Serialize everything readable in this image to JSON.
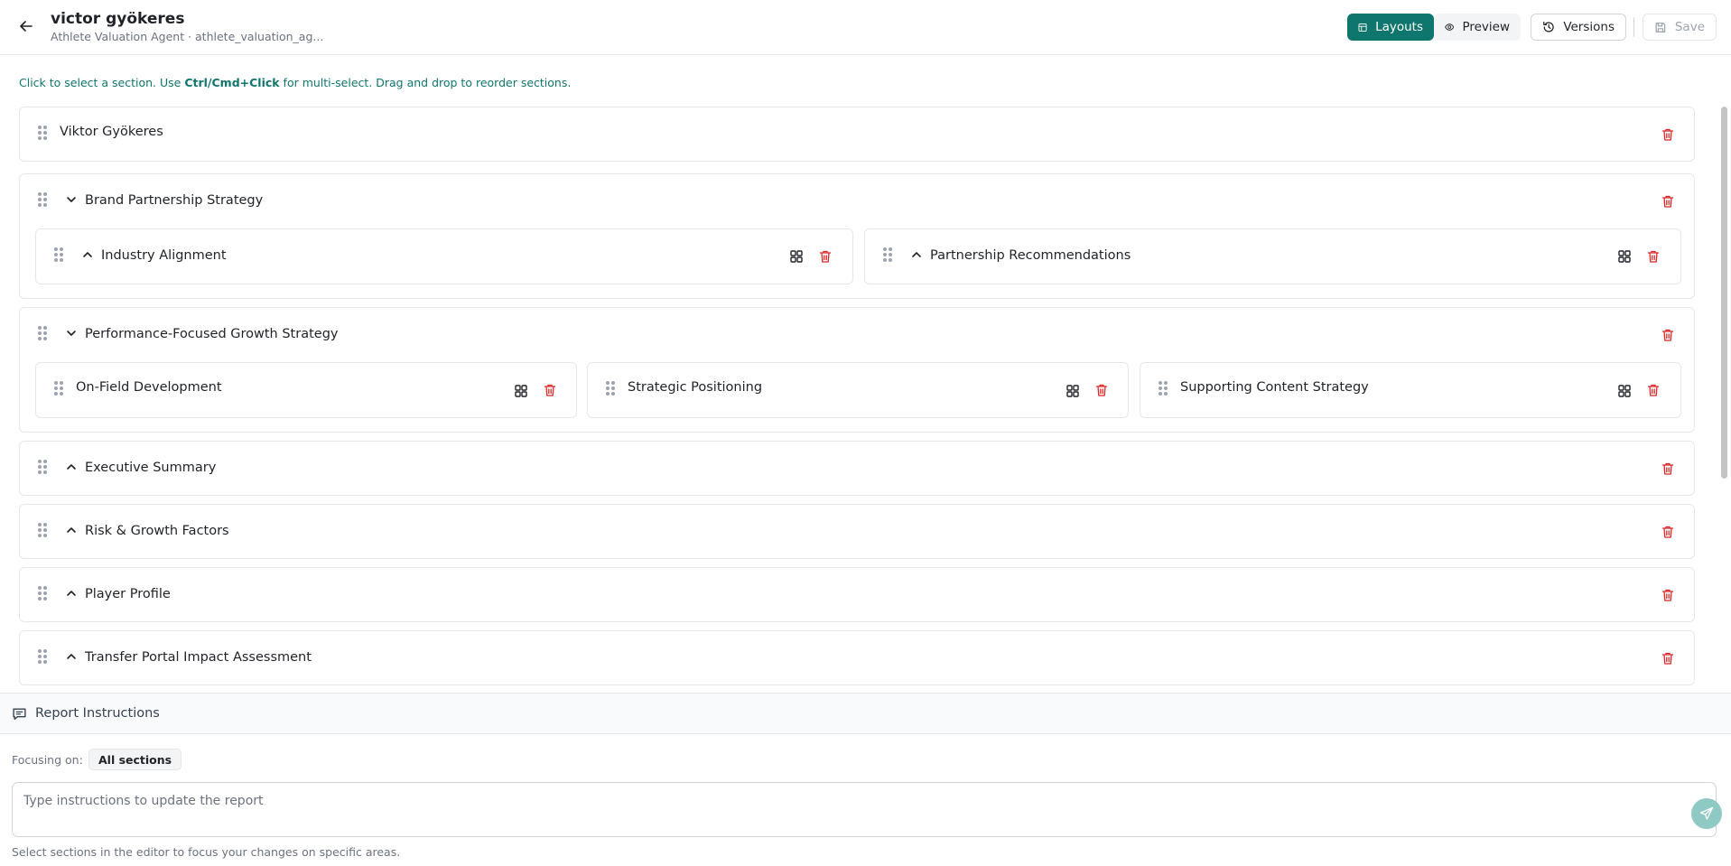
{
  "header": {
    "title": "victor gyökeres",
    "subtitle": "Athlete Valuation Agent · athlete_valuation_ag...",
    "layouts_label": "Layouts",
    "preview_label": "Preview",
    "versions_label": "Versions",
    "save_label": "Save"
  },
  "hint": {
    "prefix": "Click to select a section. Use ",
    "shortcut": "Ctrl/Cmd+Click",
    "suffix": " for multi-select. Drag and drop to reorder sections."
  },
  "sections": [
    {
      "label": "Viktor Gyökeres"
    },
    {
      "label": "Brand Partnership Strategy",
      "expanded": true,
      "children": [
        "Industry Alignment",
        "Partnership Recommendations"
      ]
    },
    {
      "label": "Performance-Focused Growth Strategy",
      "expanded": true,
      "children": [
        "On-Field Development",
        "Strategic Positioning",
        "Supporting Content Strategy"
      ]
    },
    {
      "label": "Executive Summary",
      "expanded": false
    },
    {
      "label": "Risk & Growth Factors",
      "expanded": false
    },
    {
      "label": "Player Profile",
      "expanded": false
    },
    {
      "label": "Transfer Portal Impact Assessment",
      "expanded": false
    }
  ],
  "report_instructions": {
    "title": "Report Instructions",
    "focus_label": "Focusing on:",
    "focus_value": "All sections",
    "input_value": "",
    "input_placeholder": "Type instructions to update the report",
    "footer_hint": "Select sections in the editor to focus your changes on specific areas."
  },
  "colors": {
    "accent": "#0f766e",
    "danger": "#dc2626",
    "send_button": "#8fc9c3"
  },
  "icons": {
    "back": "arrow-left-icon",
    "layouts": "layout-icon",
    "preview": "eye-icon",
    "versions": "history-icon",
    "save": "save-icon",
    "drag": "drag-handle-icon",
    "expanded": "chevron-down-icon",
    "collapsed": "chevron-up-icon",
    "delete": "trash-icon",
    "grid": "grid-icon",
    "chat": "message-square-icon",
    "send": "send-icon"
  }
}
